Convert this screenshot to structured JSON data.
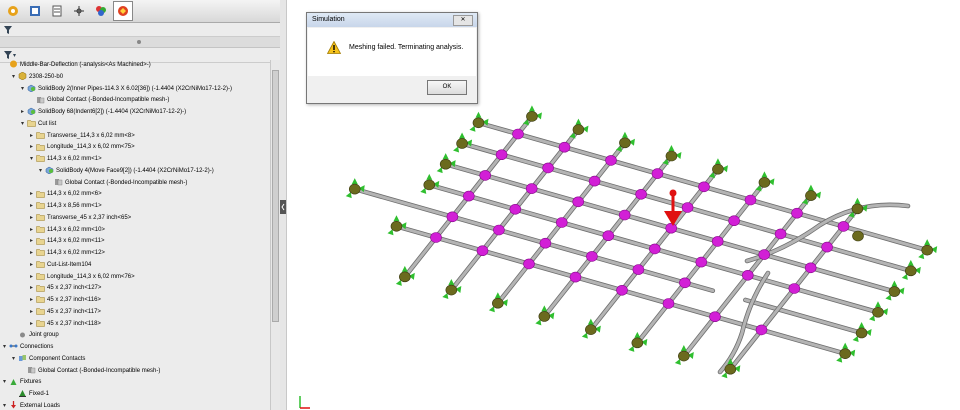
{
  "feature_tree": {
    "rows": [
      {
        "label": "Middle-Bar-Deflection (-analysis<As Machined>-)",
        "indent": 0,
        "expander": "",
        "icon": "study"
      },
      {
        "label": "2308-250-b0",
        "indent": 1,
        "expander": "▾",
        "icon": "part"
      },
      {
        "label": "SolidBody 2(Inner Pipes-114.3 X 6.02[36]) (-1.4404 (X2CrNiMo17-12-2)-)",
        "indent": 2,
        "expander": "▾",
        "icon": "solidbody"
      },
      {
        "label": "Global Contact (-Bonded-Incompatible mesh-)",
        "indent": 3,
        "expander": "",
        "icon": "contact"
      },
      {
        "label": "SolidBody 68(Indent6[2]) (-1.4404 (X2CrNiMo17-12-2)-)",
        "indent": 2,
        "expander": "▸",
        "icon": "solidbody"
      },
      {
        "label": "Cut list",
        "indent": 2,
        "expander": "▾",
        "icon": "folder"
      },
      {
        "label": "Transverse_114,3 x 6,02 mm<8>",
        "indent": 3,
        "expander": "▸",
        "icon": "folder"
      },
      {
        "label": "Longitude_114,3 x 6,02 mm<75>",
        "indent": 3,
        "expander": "▸",
        "icon": "folder"
      },
      {
        "label": "114,3 x 6,02 mm<1>",
        "indent": 3,
        "expander": "▾",
        "icon": "folder"
      },
      {
        "label": "SolidBody 4(Move Face9[2]) (-1.4404 (X2CrNiMo17-12-2)-)",
        "indent": 4,
        "expander": "▾",
        "icon": "solidbody"
      },
      {
        "label": "Global Contact (-Bonded-Incompatible mesh-)",
        "indent": 5,
        "expander": "",
        "icon": "contact"
      },
      {
        "label": "114,3 x 6,02 mm<6>",
        "indent": 3,
        "expander": "▸",
        "icon": "folder"
      },
      {
        "label": "114,3 x 8,56 mm<1>",
        "indent": 3,
        "expander": "▸",
        "icon": "folder"
      },
      {
        "label": "Transverse_45 x 2,37 inch<65>",
        "indent": 3,
        "expander": "▸",
        "icon": "folder"
      },
      {
        "label": "114,3 x 6,02 mm<10>",
        "indent": 3,
        "expander": "▸",
        "icon": "folder"
      },
      {
        "label": "114,3 x 6,02 mm<11>",
        "indent": 3,
        "expander": "▸",
        "icon": "folder"
      },
      {
        "label": "114,3 x 6,02 mm<12>",
        "indent": 3,
        "expander": "▸",
        "icon": "folder"
      },
      {
        "label": "Cut-List-Item104",
        "indent": 3,
        "expander": "▸",
        "icon": "folder"
      },
      {
        "label": "Longitude_114,3 x 6,02 mm<76>",
        "indent": 3,
        "expander": "▸",
        "icon": "folder"
      },
      {
        "label": "45 x 2,37 inch<127>",
        "indent": 3,
        "expander": "▸",
        "icon": "folder"
      },
      {
        "label": "45 x 2,37 inch<116>",
        "indent": 3,
        "expander": "▸",
        "icon": "folder"
      },
      {
        "label": "45 x 2,37 inch<117>",
        "indent": 3,
        "expander": "▸",
        "icon": "folder"
      },
      {
        "label": "45 x 2,37 inch<118>",
        "indent": 3,
        "expander": "▸",
        "icon": "folder"
      },
      {
        "label": "Joint group",
        "indent": 1,
        "expander": "",
        "icon": "joint"
      },
      {
        "label": "Connections",
        "indent": 0,
        "expander": "▾",
        "icon": "connections"
      },
      {
        "label": "Component Contacts",
        "indent": 1,
        "expander": "▾",
        "icon": "contacts"
      },
      {
        "label": "Global Contact (-Bonded-Incompatible mesh-)",
        "indent": 2,
        "expander": "",
        "icon": "contact"
      },
      {
        "label": "Fixtures",
        "indent": 0,
        "expander": "▾",
        "icon": "fixtures"
      },
      {
        "label": "Fixed-1",
        "indent": 1,
        "expander": "",
        "icon": "fixed"
      },
      {
        "label": "External Loads",
        "indent": 0,
        "expander": "▾",
        "icon": "loads"
      }
    ]
  },
  "dialog": {
    "title": "Simulation",
    "close_label": "✕",
    "message": "Meshing failed. Terminating analysis.",
    "ok_label": "OK"
  },
  "colors": {
    "node": "#d21fd6",
    "fixture": "#6b6a1e",
    "arrow_green": "#2fbf2f",
    "load_red": "#e01010",
    "annotation_red": "#e8141a",
    "pipe": "#b4b4b4"
  }
}
